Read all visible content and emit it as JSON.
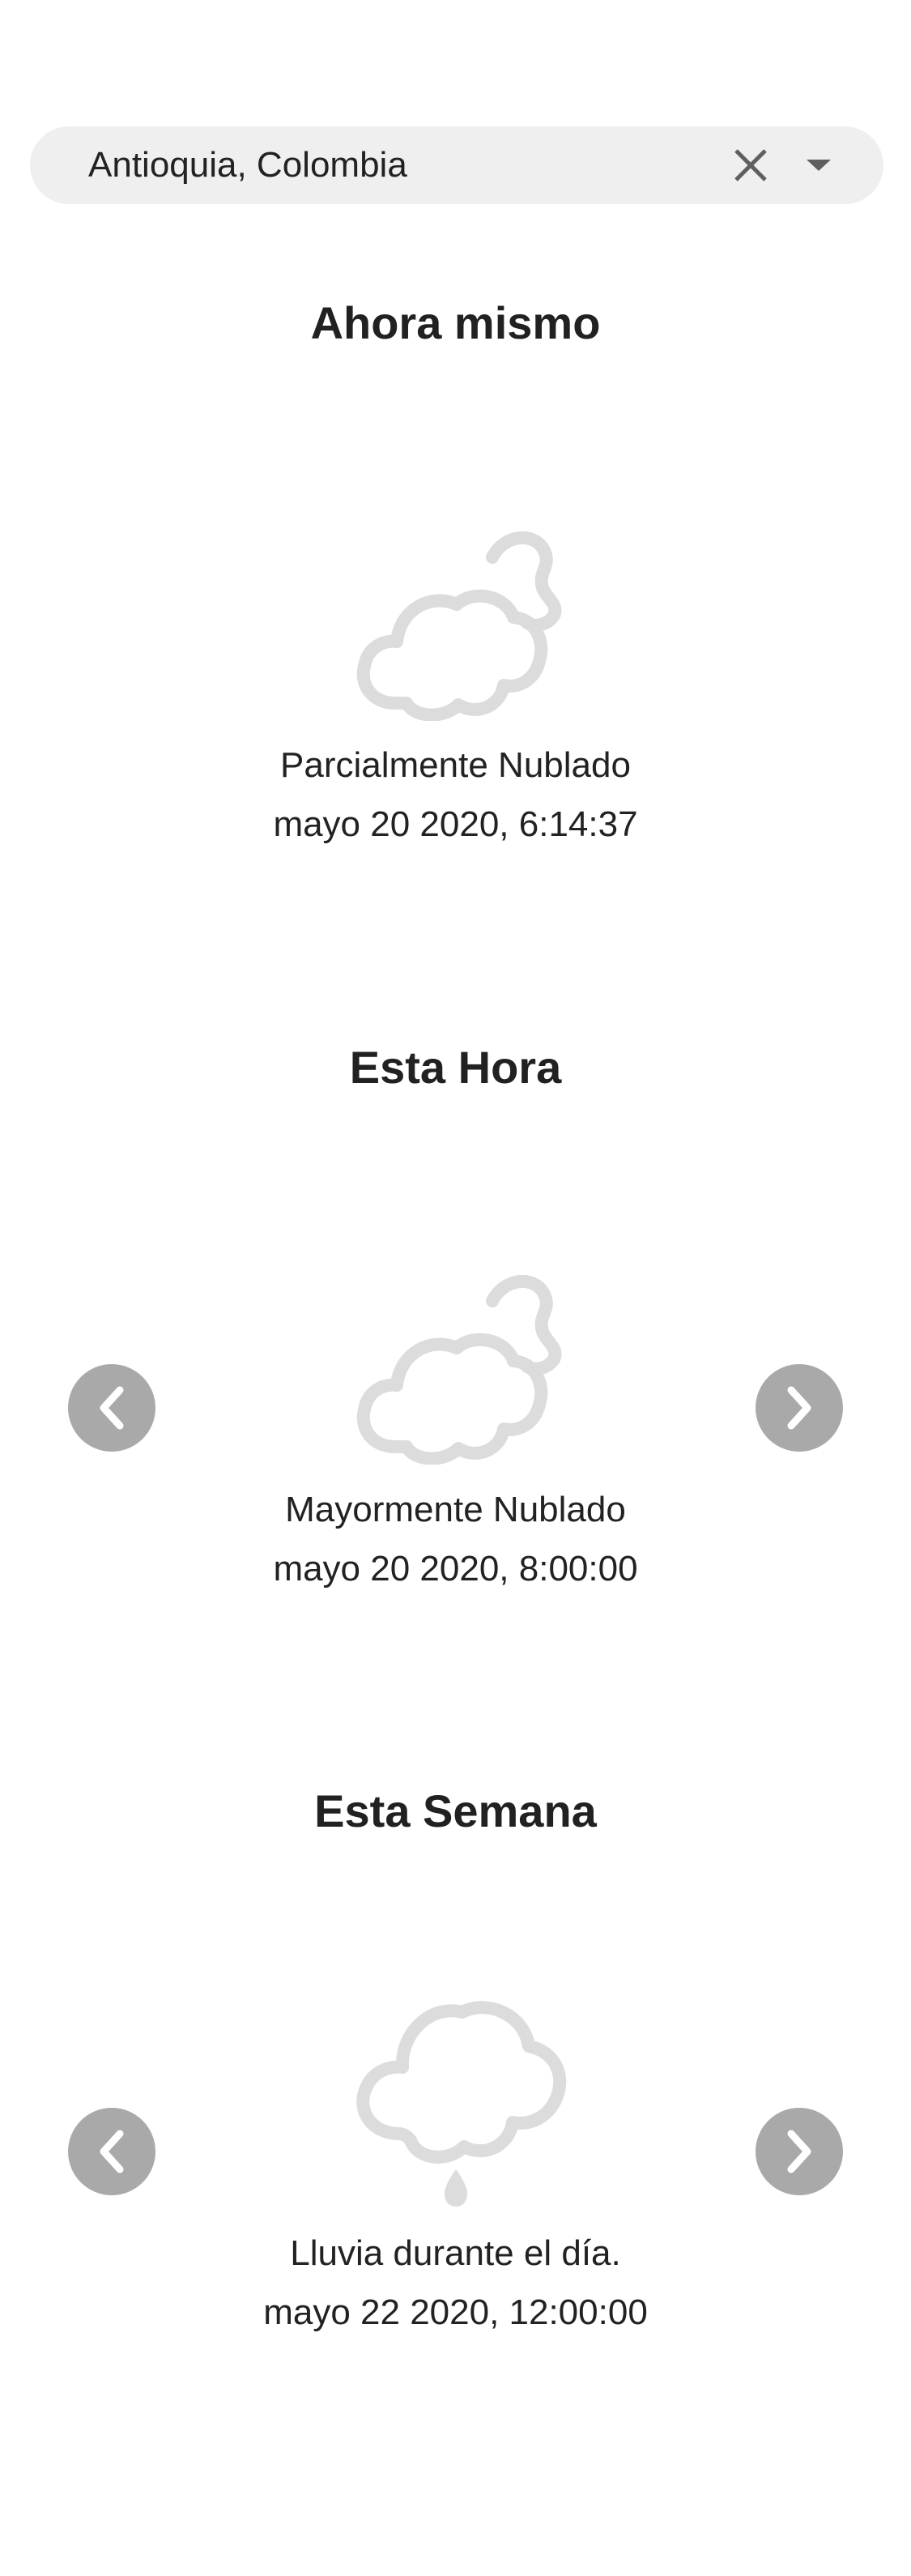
{
  "search": {
    "value": "Antioquia, Colombia",
    "clear_icon": "close-icon",
    "dropdown_icon": "caret-down-icon"
  },
  "now": {
    "title": "Ahora mismo",
    "icon": "partly-cloudy-night-icon",
    "condition": "Parcialmente Nublado",
    "datetime": "mayo 20 2020, 6:14:37"
  },
  "hour": {
    "title": "Esta Hora",
    "icon": "partly-cloudy-night-icon",
    "condition": "Mayormente Nublado",
    "datetime": "mayo 20 2020, 8:00:00",
    "prev_icon": "chevron-left-icon",
    "next_icon": "chevron-right-icon"
  },
  "week": {
    "title": "Esta Semana",
    "icon": "rain-cloud-icon",
    "condition": "Lluvia durante el día.",
    "datetime": "mayo 22 2020, 12:00:00",
    "prev_icon": "chevron-left-icon",
    "next_icon": "chevron-right-icon"
  },
  "colors": {
    "search_bg": "#efefef",
    "nav_button_bg": "#a9a9a9",
    "icon_stroke": "#dcdcdc",
    "text": "#212121"
  }
}
